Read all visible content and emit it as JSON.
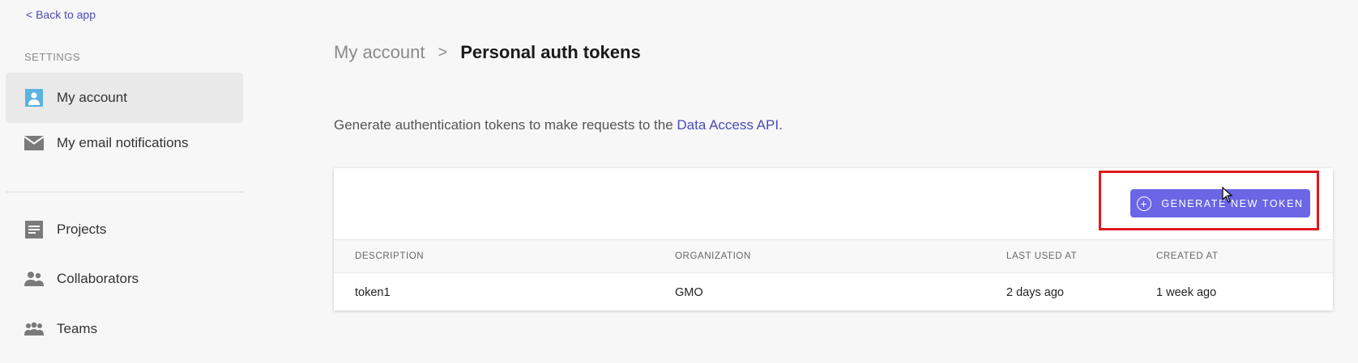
{
  "sidebar": {
    "back_link": "< Back to app",
    "section_label": "SETTINGS",
    "items": [
      {
        "label": "My account",
        "icon": "person-icon",
        "active": true
      },
      {
        "label": "My email notifications",
        "icon": "envelope-icon"
      },
      {
        "label": "Projects",
        "icon": "projects-icon"
      },
      {
        "label": "Collaborators",
        "icon": "collaborators-icon"
      },
      {
        "label": "Teams",
        "icon": "teams-icon"
      }
    ]
  },
  "breadcrumb": {
    "parent": "My account",
    "separator": ">",
    "current": "Personal auth tokens"
  },
  "intro": {
    "text": "Generate authentication tokens to make requests to the ",
    "link": "Data Access API",
    "suffix": "."
  },
  "tokens": {
    "generate_label": "GENERATE NEW TOKEN",
    "columns": [
      "DESCRIPTION",
      "ORGANIZATION",
      "LAST USED AT",
      "CREATED AT"
    ],
    "rows": [
      {
        "description": "token1",
        "organization": "GMO",
        "last_used": "2 days ago",
        "created": "1 week ago"
      }
    ]
  },
  "colors": {
    "accent": "#6b66e6",
    "link": "#4a4ab8",
    "highlight": "#e0191e",
    "icon_blue": "#5ab3e0",
    "icon_gray": "#7a7a7a"
  }
}
